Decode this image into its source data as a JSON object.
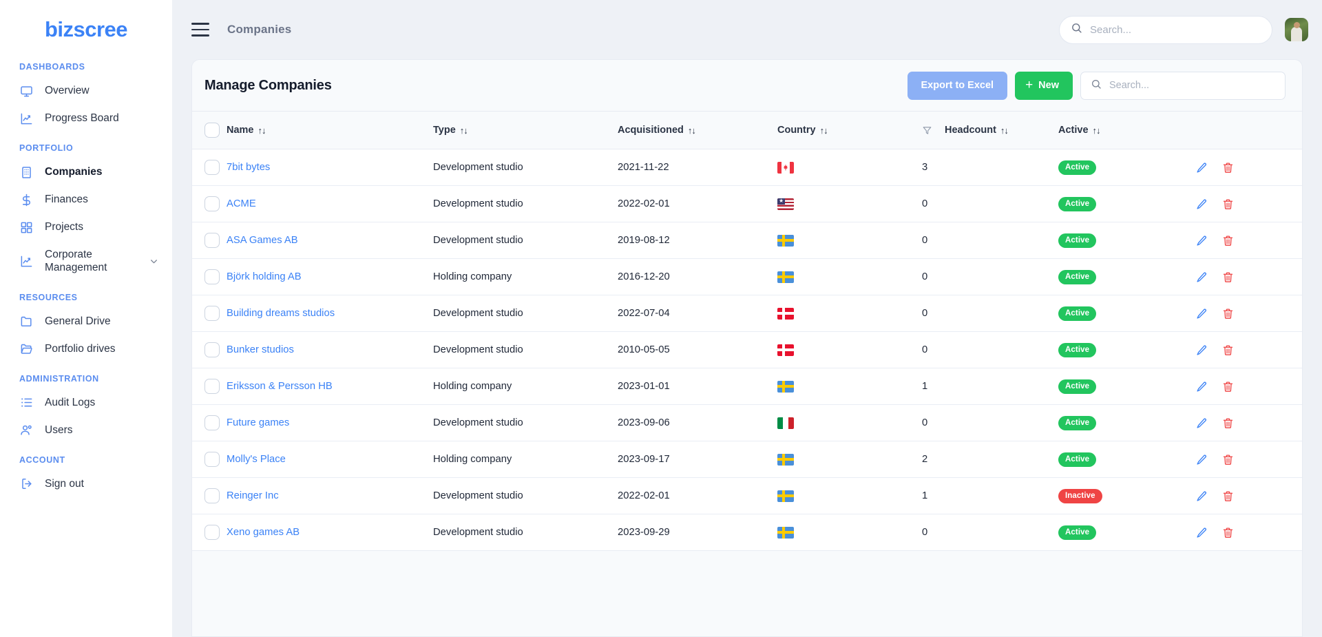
{
  "brand": {
    "name": "bizscree"
  },
  "sidebar": {
    "sections": [
      {
        "title": "DASHBOARDS",
        "items": [
          {
            "label": "Overview",
            "icon": "monitor-icon",
            "active": false
          },
          {
            "label": "Progress Board",
            "icon": "chart-line-icon",
            "active": false
          }
        ]
      },
      {
        "title": "PORTFOLIO",
        "items": [
          {
            "label": "Companies",
            "icon": "building-icon",
            "active": true
          },
          {
            "label": "Finances",
            "icon": "dollar-icon",
            "active": false
          },
          {
            "label": "Projects",
            "icon": "grid-icon",
            "active": false
          },
          {
            "label": "Corporate Management",
            "icon": "chart-line-icon",
            "active": false,
            "expandable": true
          }
        ]
      },
      {
        "title": "RESOURCES",
        "items": [
          {
            "label": "General Drive",
            "icon": "folder-icon",
            "active": false
          },
          {
            "label": "Portfolio drives",
            "icon": "folder-open-icon",
            "active": false
          }
        ]
      },
      {
        "title": "ADMINISTRATION",
        "items": [
          {
            "label": "Audit Logs",
            "icon": "list-icon",
            "active": false
          },
          {
            "label": "Users",
            "icon": "users-icon",
            "active": false
          }
        ]
      },
      {
        "title": "ACCOUNT",
        "items": [
          {
            "label": "Sign out",
            "icon": "sign-out-icon",
            "active": false
          }
        ]
      }
    ]
  },
  "topbar": {
    "title": "Companies",
    "search": {
      "value": "",
      "placeholder": "Search..."
    }
  },
  "card": {
    "title": "Manage Companies",
    "export_label": "Export to Excel",
    "new_label": "New",
    "new_plus": "+",
    "search": {
      "value": "",
      "placeholder": "Search..."
    }
  },
  "table": {
    "sort_glyph": "↑↓",
    "columns": [
      {
        "key": "checkbox",
        "label": "",
        "sortable": false
      },
      {
        "key": "name",
        "label": "Name",
        "sortable": true
      },
      {
        "key": "type",
        "label": "Type",
        "sortable": true
      },
      {
        "key": "acquisitioned",
        "label": "Acquisitioned",
        "sortable": true
      },
      {
        "key": "country",
        "label": "Country",
        "sortable": true
      },
      {
        "key": "headcount",
        "label": "Headcount",
        "sortable": true,
        "filter": true
      },
      {
        "key": "active",
        "label": "Active",
        "sortable": true
      },
      {
        "key": "operations",
        "label": "",
        "sortable": false
      }
    ],
    "rows": [
      {
        "name": "7bit bytes",
        "type": "Development studio",
        "acquisitioned": "2021-11-22",
        "country": "ca",
        "headcount": "3",
        "status": "Active",
        "status_kind": "active"
      },
      {
        "name": "ACME",
        "type": "Development studio",
        "acquisitioned": "2022-02-01",
        "country": "us",
        "headcount": "0",
        "status": "Active",
        "status_kind": "active"
      },
      {
        "name": "ASA Games AB",
        "type": "Development studio",
        "acquisitioned": "2019-08-12",
        "country": "se",
        "headcount": "0",
        "status": "Active",
        "status_kind": "active"
      },
      {
        "name": "Björk holding AB",
        "type": "Holding company",
        "acquisitioned": "2016-12-20",
        "country": "se",
        "headcount": "0",
        "status": "Active",
        "status_kind": "active"
      },
      {
        "name": "Building dreams studios",
        "type": "Development studio",
        "acquisitioned": "2022-07-04",
        "country": "dk",
        "headcount": "0",
        "status": "Active",
        "status_kind": "active"
      },
      {
        "name": "Bunker studios",
        "type": "Development studio",
        "acquisitioned": "2010-05-05",
        "country": "dk",
        "headcount": "0",
        "status": "Active",
        "status_kind": "active"
      },
      {
        "name": "Eriksson & Persson HB",
        "type": "Holding company",
        "acquisitioned": "2023-01-01",
        "country": "se",
        "headcount": "1",
        "status": "Active",
        "status_kind": "active"
      },
      {
        "name": "Future games",
        "type": "Development studio",
        "acquisitioned": "2023-09-06",
        "country": "it",
        "headcount": "0",
        "status": "Active",
        "status_kind": "active"
      },
      {
        "name": "Molly's Place",
        "type": "Holding company",
        "acquisitioned": "2023-09-17",
        "country": "se",
        "headcount": "2",
        "status": "Active",
        "status_kind": "active"
      },
      {
        "name": "Reinger Inc",
        "type": "Development studio",
        "acquisitioned": "2022-02-01",
        "country": "se",
        "headcount": "1",
        "status": "Inactive",
        "status_kind": "inactive"
      },
      {
        "name": "Xeno games AB",
        "type": "Development studio",
        "acquisitioned": "2023-09-29",
        "country": "se",
        "headcount": "0",
        "status": "Active",
        "status_kind": "active"
      }
    ]
  },
  "colors": {
    "brand_blue": "#3b82f6",
    "green": "#22c55e",
    "red": "#ef4444",
    "export_blue": "#8cb0f5",
    "page_bg": "#eef1f6"
  }
}
